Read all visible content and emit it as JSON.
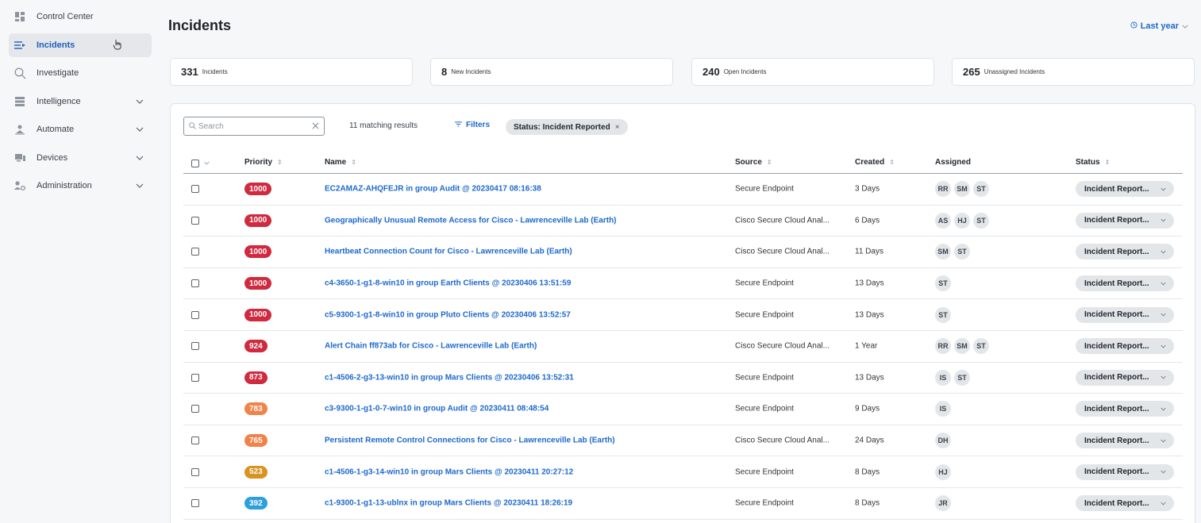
{
  "sidebar": {
    "items": [
      {
        "label": "Control Center",
        "icon": "dashboard-icon",
        "expandable": false,
        "active": false
      },
      {
        "label": "Incidents",
        "icon": "incidents-icon",
        "expandable": false,
        "active": true
      },
      {
        "label": "Investigate",
        "icon": "search-icon",
        "expandable": false,
        "active": false
      },
      {
        "label": "Intelligence",
        "icon": "intelligence-icon",
        "expandable": true,
        "active": false
      },
      {
        "label": "Automate",
        "icon": "automate-icon",
        "expandable": true,
        "active": false
      },
      {
        "label": "Devices",
        "icon": "devices-icon",
        "expandable": true,
        "active": false
      },
      {
        "label": "Administration",
        "icon": "administration-icon",
        "expandable": true,
        "active": false
      }
    ]
  },
  "header": {
    "title": "Incidents",
    "time_range": "Last year"
  },
  "stats": [
    {
      "value": "331",
      "label": "Incidents"
    },
    {
      "value": "8",
      "label": "New Incidents"
    },
    {
      "value": "240",
      "label": "Open Incidents"
    },
    {
      "value": "265",
      "label": "Unassigned Incidents"
    }
  ],
  "toolbar": {
    "search_placeholder": "Search",
    "matching_results": "11 matching results",
    "filters_label": "Filters",
    "active_filter": "Status: Incident Reported",
    "filter_remove": "×"
  },
  "table": {
    "columns": {
      "priority": "Priority",
      "name": "Name",
      "source": "Source",
      "created": "Created",
      "assigned": "Assigned",
      "status": "Status"
    },
    "rows": [
      {
        "priority": "1000",
        "color": "#cf2a3f",
        "name": "EC2AMAZ-AHQFEJR in group Audit @ 20230417 08:16:38",
        "source": "Secure Endpoint",
        "created": "3 Days",
        "assigned": [
          "RR",
          "SM",
          "ST"
        ],
        "status": "Incident Report..."
      },
      {
        "priority": "1000",
        "color": "#cf2a3f",
        "name": "Geographically Unusual Remote Access for Cisco - Lawrenceville Lab (Earth)",
        "source": "Cisco Secure Cloud Anal...",
        "created": "6 Days",
        "assigned": [
          "AS",
          "HJ",
          "ST"
        ],
        "status": "Incident Report..."
      },
      {
        "priority": "1000",
        "color": "#cf2a3f",
        "name": "Heartbeat Connection Count for Cisco - Lawrenceville Lab (Earth)",
        "source": "Cisco Secure Cloud Anal...",
        "created": "11 Days",
        "assigned": [
          "SM",
          "ST"
        ],
        "status": "Incident Report..."
      },
      {
        "priority": "1000",
        "color": "#cf2a3f",
        "name": "c4-3650-1-g1-8-win10 in group Earth Clients @ 20230406 13:51:59",
        "source": "Secure Endpoint",
        "created": "13 Days",
        "assigned": [
          "ST"
        ],
        "status": "Incident Report..."
      },
      {
        "priority": "1000",
        "color": "#cf2a3f",
        "name": "c5-9300-1-g1-8-win10 in group Pluto Clients @ 20230406 13:52:57",
        "source": "Secure Endpoint",
        "created": "13 Days",
        "assigned": [
          "ST"
        ],
        "status": "Incident Report..."
      },
      {
        "priority": "924",
        "color": "#cf2a3f",
        "name": "Alert Chain ff873ab for Cisco - Lawrenceville Lab (Earth)",
        "source": "Cisco Secure Cloud Anal...",
        "created": "1 Year",
        "assigned": [
          "RR",
          "SM",
          "ST"
        ],
        "status": "Incident Report..."
      },
      {
        "priority": "873",
        "color": "#cf2a3f",
        "name": "c1-4506-2-g3-13-win10 in group Mars Clients @ 20230406 13:52:31",
        "source": "Secure Endpoint",
        "created": "13 Days",
        "assigned": [
          "IS",
          "ST"
        ],
        "status": "Incident Report..."
      },
      {
        "priority": "783",
        "color": "#f0834a",
        "name": "c3-9300-1-g1-0-7-win10 in group Audit @ 20230411 08:48:54",
        "source": "Secure Endpoint",
        "created": "9 Days",
        "assigned": [
          "IS"
        ],
        "status": "Incident Report..."
      },
      {
        "priority": "765",
        "color": "#f0834a",
        "name": "Persistent Remote Control Connections for Cisco - Lawrenceville Lab (Earth)",
        "source": "Cisco Secure Cloud Anal...",
        "created": "24 Days",
        "assigned": [
          "DH"
        ],
        "status": "Incident Report..."
      },
      {
        "priority": "523",
        "color": "#d99321",
        "name": "c1-4506-1-g3-14-win10 in group Mars Clients @ 20230411 20:27:12",
        "source": "Secure Endpoint",
        "created": "8 Days",
        "assigned": [
          "HJ"
        ],
        "status": "Incident Report..."
      },
      {
        "priority": "392",
        "color": "#2d9fdf",
        "name": "c1-9300-1-g1-13-ublnx in group Mars Clients @ 20230411 18:26:19",
        "source": "Secure Endpoint",
        "created": "8 Days",
        "assigned": [
          "JR"
        ],
        "status": "Incident Report..."
      }
    ]
  },
  "colors": {
    "accent": "#1d69cc",
    "critical": "#cf2a3f",
    "high": "#f0834a",
    "medium": "#d99321",
    "low": "#2d9fdf"
  }
}
